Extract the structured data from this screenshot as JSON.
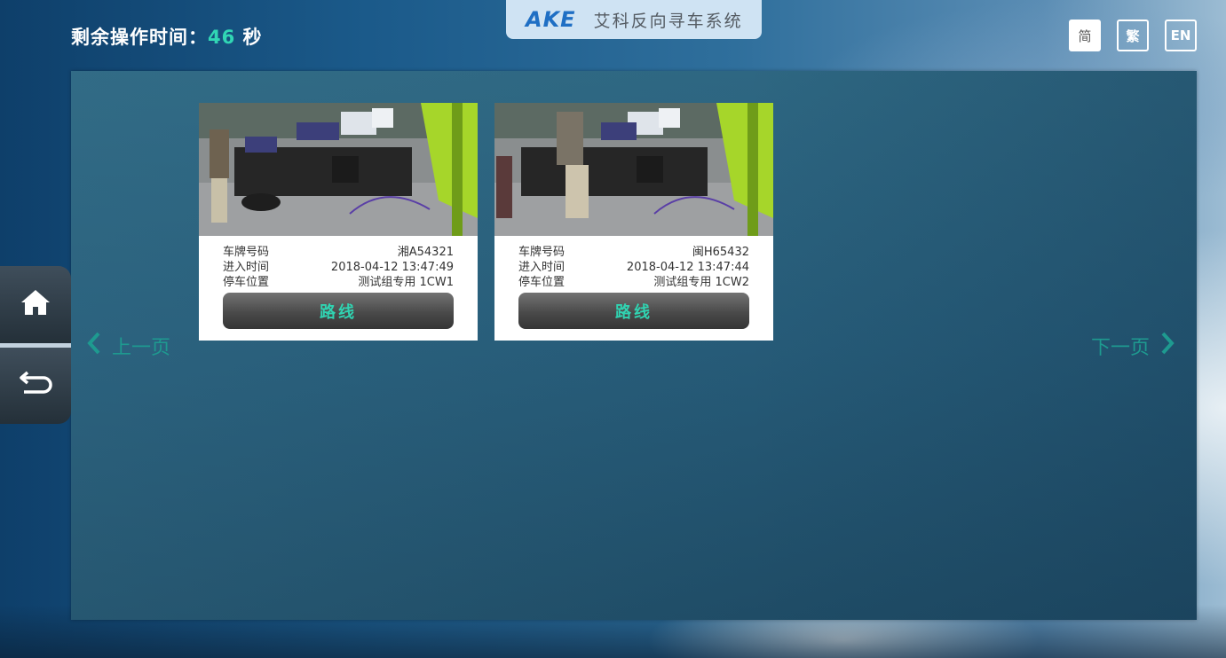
{
  "header": {
    "countdown_label": "剩余操作时间：",
    "countdown_value": "46",
    "countdown_unit": "秒",
    "logo_mark": "AKE",
    "system_name": "艾科反向寻车系统"
  },
  "languages": [
    {
      "label": "简",
      "active": true
    },
    {
      "label": "繁",
      "active": false
    },
    {
      "label": "EN",
      "active": false
    }
  ],
  "side_nav": {
    "home_icon": "home-icon",
    "back_icon": "return-icon"
  },
  "pager": {
    "prev_label": "上一页",
    "next_label": "下一页"
  },
  "vehicles": [
    {
      "plate_label": "车牌号码",
      "plate_value": "湘A54321",
      "time_label": "进入时间",
      "time_value": "2018-04-12 13:47:49",
      "spot_label": "停车位置",
      "spot_value": "测试组专用 1CW1",
      "route_label": "路线"
    },
    {
      "plate_label": "车牌号码",
      "plate_value": "闽H65432",
      "time_label": "进入时间",
      "time_value": "2018-04-12 13:47:44",
      "spot_label": "停车位置",
      "spot_value": "测试组专用 1CW2",
      "route_label": "路线"
    }
  ],
  "colors": {
    "accent": "#31d6b4",
    "pager": "#1e9a90",
    "logo": "#1f6fc4"
  }
}
